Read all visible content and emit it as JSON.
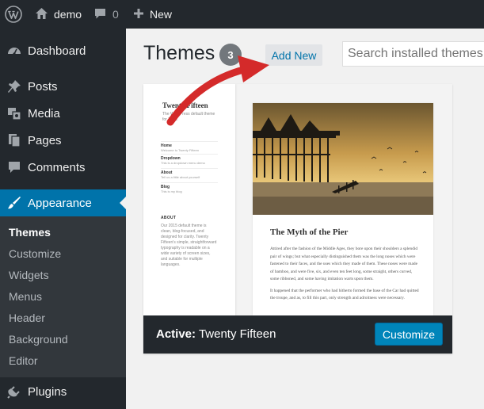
{
  "admin_bar": {
    "site_name": "demo",
    "comments_count": "0",
    "new_label": "New"
  },
  "sidebar": {
    "items": [
      {
        "label": "Dashboard",
        "icon": "dashboard-icon"
      },
      {
        "label": "Posts",
        "icon": "pin-icon"
      },
      {
        "label": "Media",
        "icon": "media-icon"
      },
      {
        "label": "Pages",
        "icon": "pages-icon"
      },
      {
        "label": "Comments",
        "icon": "comment-icon"
      },
      {
        "label": "Appearance",
        "icon": "brush-icon"
      },
      {
        "label": "Plugins",
        "icon": "plugin-icon"
      }
    ],
    "submenu": [
      "Themes",
      "Customize",
      "Widgets",
      "Menus",
      "Header",
      "Background",
      "Editor"
    ]
  },
  "header": {
    "title": "Themes",
    "count": "3",
    "add_new": "Add New",
    "search_placeholder": "Search installed themes..."
  },
  "theme": {
    "site_title": "Twenty Fifteen",
    "tagline": "The WordPress default theme for 2015.",
    "nav": [
      {
        "name": "Home",
        "desc": "Welcome to Twenty Fifteen"
      },
      {
        "name": "Dropdown",
        "desc": "This is a dropdown menu demo"
      },
      {
        "name": "About",
        "desc": "Tell us a little about yourself"
      },
      {
        "name": "Blog",
        "desc": "This is my blog"
      }
    ],
    "about_title": "ABOUT",
    "about_text": "Our 2015 default theme is clean, blog-focused, and designed for clarity. Twenty Fifteen's simple, straightforward typography is readable on a wide variety of screen sizes, and suitable for multiple languages.",
    "post_title": "The Myth of the Pier",
    "post_p1": "Attired after the fashion of the Middle Ages, they bore upon their shoulders a splendid pair of wings; but what especially distinguished them was the long noses which were fastened to their faces, and the uses which they made of them. These noses were made of bamboo, and were five, six, and even ten feet long, some straight, others curved, some ribboned, and some having imitation warts upon them.",
    "post_p2": "It happened that the performer who had hitherto formed the base of the Car had quitted the troupe, and as, to fill this part, only strength and adroitness were necessary.",
    "active_prefix": "Active:",
    "active_name": "Twenty Fifteen",
    "customize_label": "Customize"
  },
  "colors": {
    "admin_bar": "#23282d",
    "accent": "#0073aa",
    "annotation_arrow": "#d42a2a"
  }
}
